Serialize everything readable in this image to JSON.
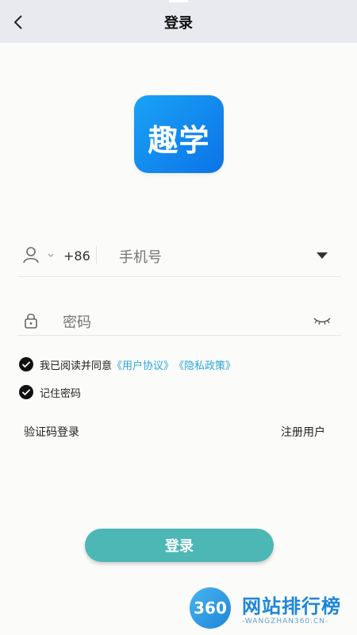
{
  "header": {
    "title": "登录",
    "back_icon": "chevron-left-icon"
  },
  "logo": {
    "text": "趣学"
  },
  "phone": {
    "country_code": "+86",
    "placeholder": "手机号"
  },
  "password": {
    "placeholder": "密码"
  },
  "agreement": {
    "prefix": "我已阅读并同意",
    "user_agreement": "《用户协议》",
    "privacy_policy": "《隐私政策》"
  },
  "remember": {
    "label": "记住密码"
  },
  "links": {
    "sms_login": "验证码登录",
    "register": "注册用户"
  },
  "login_button": {
    "label": "登录"
  },
  "watermark": {
    "badge": "360",
    "name": "网站排行榜",
    "sub": "-WANGZHAN360.CN-"
  },
  "colors": {
    "accent": "#4db7b6",
    "link": "#2aa7d8",
    "logo": "#0b73e8"
  }
}
